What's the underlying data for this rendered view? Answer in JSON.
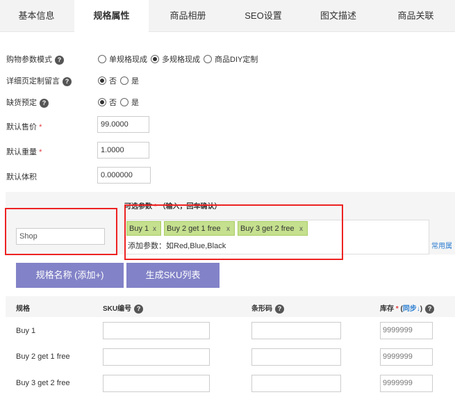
{
  "tabs": [
    "基本信息",
    "规格属性",
    "商品相册",
    "SEO设置",
    "图文描述",
    "商品关联"
  ],
  "form": {
    "purchase_mode": {
      "label": "购物参数模式",
      "options": [
        "单规格现成",
        "多规格现成",
        "商品DIY定制"
      ],
      "selected": 1
    },
    "custom_message": {
      "label": "详细页定制留言",
      "options": [
        "否",
        "是"
      ],
      "selected": 0
    },
    "backorder": {
      "label": "缺货预定",
      "options": [
        "否",
        "是"
      ],
      "selected": 0
    },
    "price": {
      "label": "默认售价",
      "value": "99.0000"
    },
    "weight": {
      "label": "默认重量",
      "value": "1.0000"
    },
    "volume": {
      "label": "默认体积",
      "value": "0.000000"
    }
  },
  "spec": {
    "header": "可选参数",
    "header_hint": "（输入，回车确认）",
    "name_value": "Shop",
    "tags": [
      "Buy 1",
      "Buy 2 get 1 free",
      "Buy 3 get 2 free"
    ],
    "tag_remove": "x",
    "add_prefix": "添加参数：",
    "add_placeholder": "如Red,Blue,Black",
    "common_link": "常用属"
  },
  "buttons": {
    "add_spec": "规格名称 (添加+)",
    "gen_sku": "生成SKU列表"
  },
  "table": {
    "col_spec": "规格",
    "col_sku": "SKU编号",
    "col_barcode": "条形码",
    "col_stock": "库存",
    "col_stock_sync": "同步↓",
    "rows": [
      {
        "name": "Buy 1",
        "stock": "9999999"
      },
      {
        "name": "Buy 2 get 1 free",
        "stock": "9999999"
      },
      {
        "name": "Buy 3 get 2 free",
        "stock": "9999999"
      }
    ]
  },
  "colors": {
    "button": "#8282c8",
    "tag": "#c5e08e",
    "highlight": "#e22222",
    "link": "#2a7dd1"
  }
}
